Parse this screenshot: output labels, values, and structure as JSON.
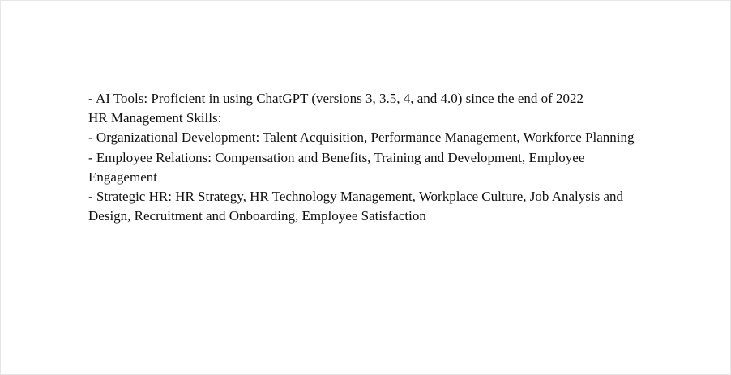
{
  "document": {
    "lines": [
      "- AI Tools: Proficient in using ChatGPT (versions 3, 3.5, 4, and 4.0) since the end of 2022",
      "HR Management Skills:",
      "- Organizational Development: Talent Acquisition, Performance Management, Workforce Planning",
      "- Employee Relations: Compensation and Benefits, Training and Development, Employee Engagement",
      "- Strategic HR: HR Strategy, HR Technology Management, Workplace Culture, Job Analysis and Design, Recruitment and Onboarding, Employee Satisfaction"
    ]
  }
}
